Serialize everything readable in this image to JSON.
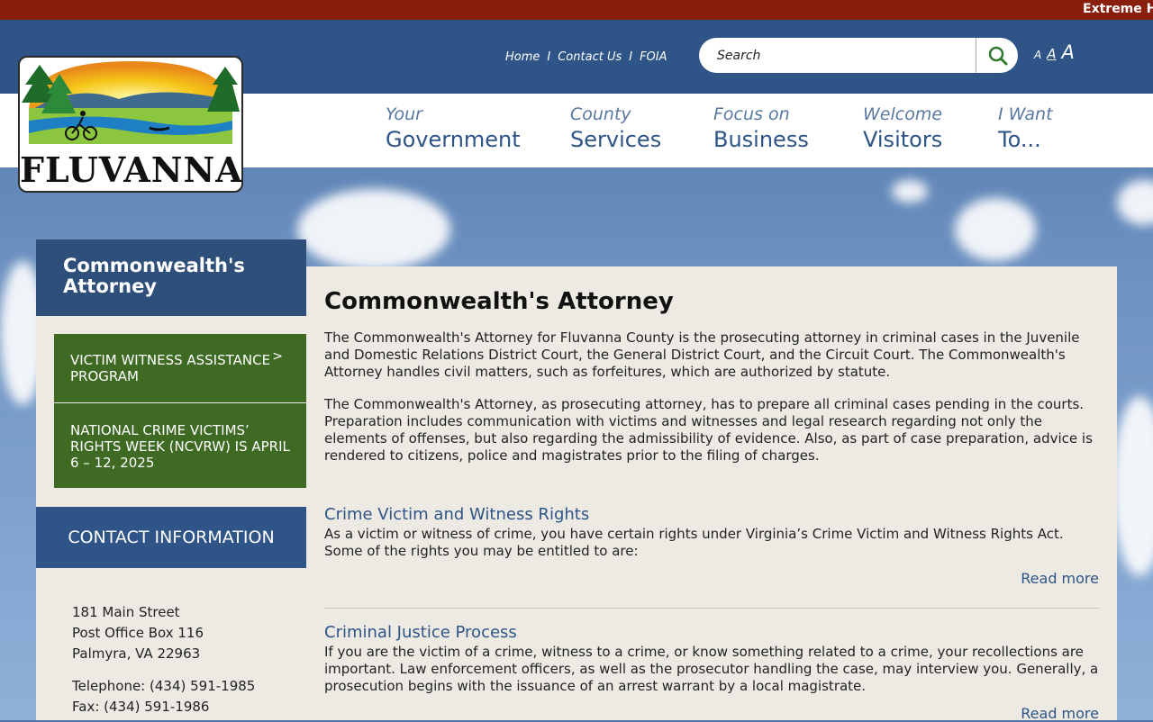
{
  "alert": {
    "text": "Extreme He"
  },
  "utility_nav": {
    "home": "Home",
    "contact": "Contact Us",
    "foia": "FOIA",
    "separator": "I"
  },
  "search": {
    "placeholder": "Search"
  },
  "text_size": {
    "small": "A",
    "medium": "A",
    "large": "A"
  },
  "logo": {
    "text": "FLUVANNA"
  },
  "main_nav": [
    {
      "small": "Your",
      "big": "Government"
    },
    {
      "small": "County",
      "big": "Services"
    },
    {
      "small": "Focus on",
      "big": "Business"
    },
    {
      "small": "Welcome",
      "big": "Visitors"
    },
    {
      "small": "I Want",
      "big": "To..."
    }
  ],
  "sidebar": {
    "title": "Commonwealth's Attorney",
    "links": [
      {
        "label": "VICTIM WITNESS ASSISTANCE PROGRAM",
        "chevron": ">"
      },
      {
        "label": "NATIONAL CRIME VICTIMS’ RIGHTS WEEK (NCVRW) IS APRIL 6 – 12, 2025"
      }
    ],
    "contact_heading": "CONTACT INFORMATION",
    "contact": {
      "street": "181 Main Street",
      "po_box": "Post Office Box 116",
      "city": "Palmyra, VA 22963",
      "telephone": "Telephone: (434) 591-1985",
      "fax": "Fax: (434) 591-1986"
    }
  },
  "content": {
    "title": "Commonwealth's Attorney",
    "paragraphs": [
      "The Commonwealth's Attorney for Fluvanna County is the prosecuting attorney in criminal cases in the Juvenile and Domestic Relations District Court, the General District Court, and the Circuit Court. The Commonwealth's Attorney handles civil matters, such as forfeitures, which are authorized by statute.",
      "The Commonwealth's Attorney, as prosecuting attorney, has to prepare all criminal cases pending in the courts. Preparation includes communication with victims and witnesses and legal research regarding not only the elements of offenses, but also regarding the admissibility of evidence. Also, as part of case preparation, advice is rendered to citizens, police and magistrates prior to the filing of charges."
    ],
    "sections": [
      {
        "title": "Crime Victim and Witness Rights",
        "text": "As a victim or witness of crime, you have certain rights under Virginia’s Crime Victim and Witness Rights Act. Some of the rights you may be entitled to are:",
        "link": "Read more"
      },
      {
        "title": "Criminal Justice Process",
        "text": "If you are the victim of a crime, witness to a crime, or know something related to a crime, your recollections are important. Law enforcement officers, as well as the prosecutor handling the case, may interview you. Generally, a prosecution begins with the issuance of an arrest warrant by a local magistrate.",
        "link": "Read more"
      }
    ]
  },
  "colors": {
    "header": "#2e5488",
    "alert": "#8a1e0c",
    "sidebar_link": "#3e6a24",
    "panel": "#eceae3"
  }
}
